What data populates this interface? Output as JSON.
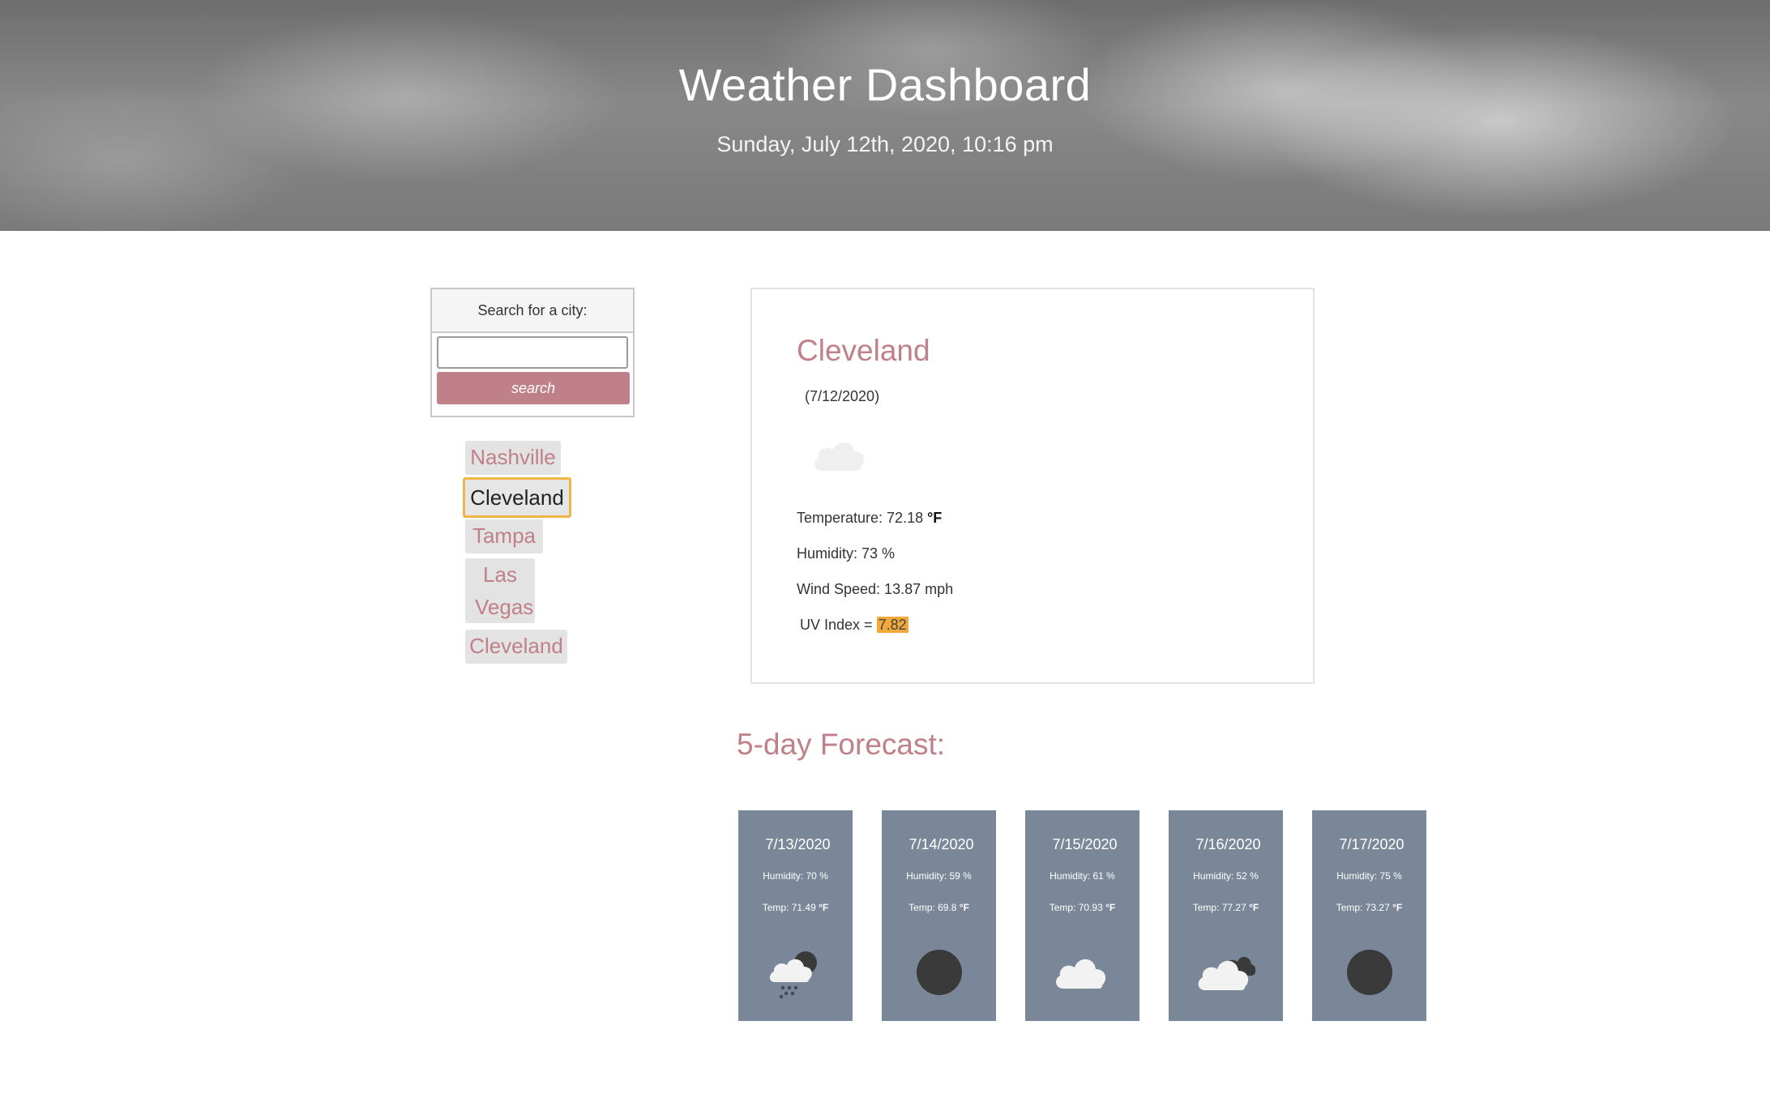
{
  "header": {
    "title": "Weather Dashboard",
    "datetime": "Sunday, July 12th, 2020, 10:16 pm"
  },
  "search": {
    "heading": "Search for a city:",
    "input_value": "",
    "placeholder": "",
    "button_label": "search"
  },
  "history": [
    "Nashville",
    "Cleveland",
    "Tampa",
    "Las Vegas",
    "Cleveland"
  ],
  "current": {
    "city": "Cleveland",
    "date": "(7/12/2020)",
    "icon": "cloud-icon",
    "temperature_label": "Temperature: 72.18",
    "temperature_unit": "°F",
    "humidity": "Humidity: 73 %",
    "wind": "Wind Speed: 13.87 mph",
    "uv_label": "UV Index =",
    "uv_value": "7.82",
    "uv_color": "#f2a93a"
  },
  "forecast": {
    "title": "5-day Forecast:",
    "days": [
      {
        "date": "7/13/2020",
        "humidity": "Humidity: 70 %",
        "temp": "Temp: 71.49",
        "unit": "°F",
        "icon": "rain-cloud-moon-icon"
      },
      {
        "date": "7/14/2020",
        "humidity": "Humidity: 59 %",
        "temp": "Temp: 69.8",
        "unit": "°F",
        "icon": "moon-icon"
      },
      {
        "date": "7/15/2020",
        "humidity": "Humidity: 61 %",
        "temp": "Temp: 70.93",
        "unit": "°F",
        "icon": "cloud-icon"
      },
      {
        "date": "7/16/2020",
        "humidity": "Humidity: 52 %",
        "temp": "Temp: 77.27",
        "unit": "°F",
        "icon": "cloud-dark-cloud-icon"
      },
      {
        "date": "7/17/2020",
        "humidity": "Humidity: 75 %",
        "temp": "Temp: 73.27",
        "unit": "°F",
        "icon": "moon-icon"
      }
    ]
  },
  "colors": {
    "accent": "#c0808a",
    "card": "#7a8798",
    "active_border": "#f0b547"
  }
}
